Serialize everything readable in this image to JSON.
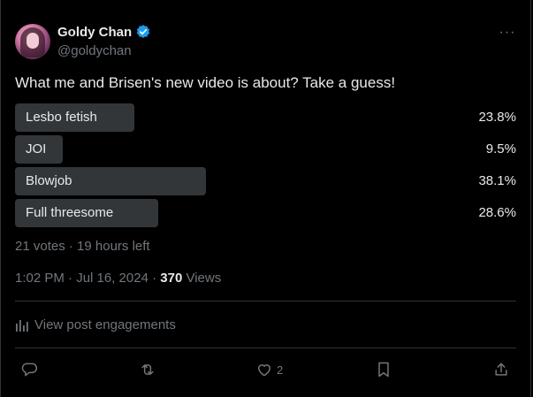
{
  "author": {
    "name": "Goldy Chan",
    "handle": "@goldychan"
  },
  "post": {
    "text": "What me and Brisen's new video is about? Take a guess!"
  },
  "poll": {
    "options": [
      {
        "label": "Lesbo fetish",
        "percent": "23.8%",
        "share": 0.238
      },
      {
        "label": "JOI",
        "percent": "9.5%",
        "share": 0.095
      },
      {
        "label": "Blowjob",
        "percent": "38.1%",
        "share": 0.381
      },
      {
        "label": "Full threesome",
        "percent": "28.6%",
        "share": 0.286
      }
    ],
    "meta": "21 votes · 19 hours left"
  },
  "timestamp": {
    "time": "1:02 PM · Jul 16, 2024 · ",
    "views_count": "370",
    "views_label": " Views"
  },
  "engagements": {
    "label": "View post engagements"
  },
  "actions": {
    "like_count": "2"
  },
  "icons": [
    "verified-badge-icon",
    "more-icon",
    "analytics-icon",
    "reply-icon",
    "repost-icon",
    "like-icon",
    "bookmark-icon",
    "share-icon"
  ],
  "colors": {
    "background": "#000000",
    "text": "#e7e9ea",
    "muted": "#71767b",
    "bar": "#333639",
    "verified": "#1d9bf0"
  }
}
